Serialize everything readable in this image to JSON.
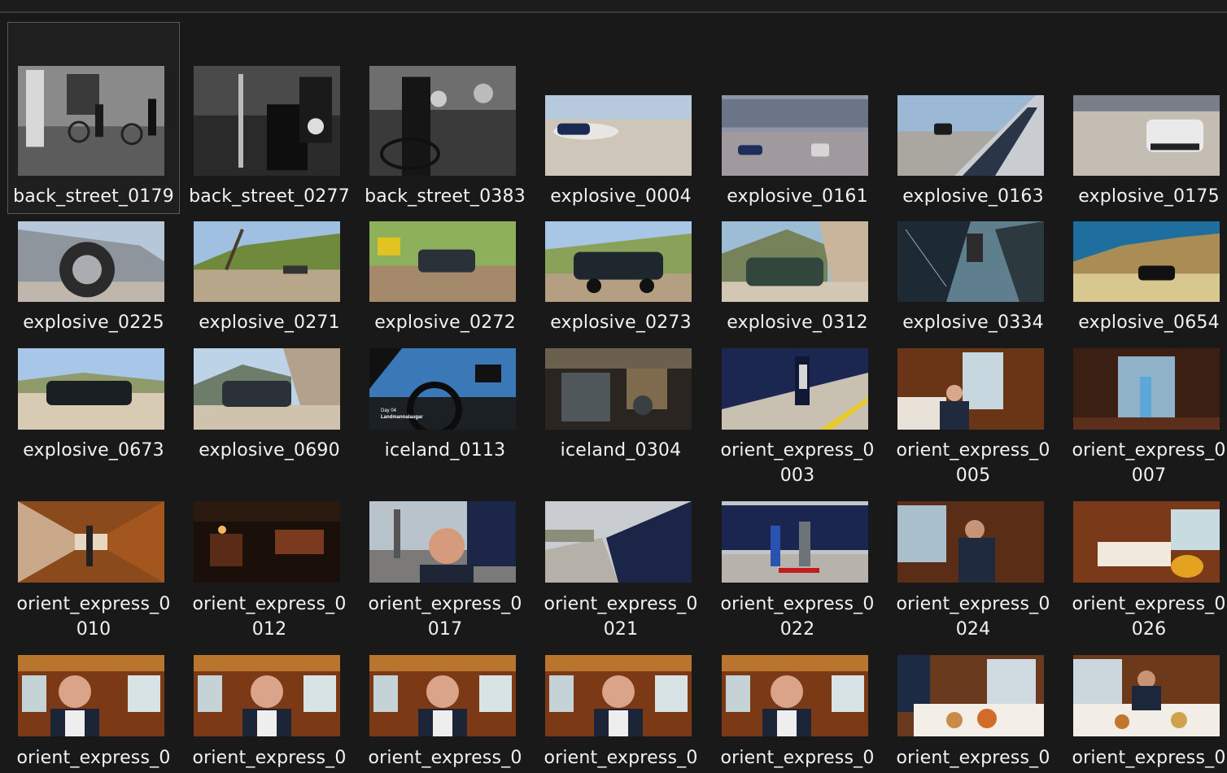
{
  "files": [
    {
      "name": "back_street_0179",
      "scene": "bw_street",
      "selected": true
    },
    {
      "name": "back_street_0277",
      "scene": "bw_carriage"
    },
    {
      "name": "back_street_0383",
      "scene": "bw_crowd"
    },
    {
      "name": "explosive_0004",
      "scene": "runway_car"
    },
    {
      "name": "explosive_0161",
      "scene": "runway_city"
    },
    {
      "name": "explosive_0163",
      "scene": "car_door"
    },
    {
      "name": "explosive_0175",
      "scene": "runway_white_car"
    },
    {
      "name": "explosive_0225",
      "scene": "wheel_closeup"
    },
    {
      "name": "explosive_0271",
      "scene": "hill_tree"
    },
    {
      "name": "explosive_0272",
      "scene": "hill_tow"
    },
    {
      "name": "explosive_0273",
      "scene": "hill_wagon"
    },
    {
      "name": "explosive_0312",
      "scene": "rock_wagon"
    },
    {
      "name": "explosive_0334",
      "scene": "broken_window"
    },
    {
      "name": "explosive_0654",
      "scene": "desert_hill_car"
    },
    {
      "name": "explosive_0673",
      "scene": "desert_wagon"
    },
    {
      "name": "explosive_0690",
      "scene": "mountain_wagon"
    },
    {
      "name": "iceland_0113",
      "scene": "car_interior_sky",
      "overlay": "Day 04\nLandmannalaugar"
    },
    {
      "name": "iceland_0304",
      "scene": "train_cab"
    },
    {
      "name": "orient_express_0\n003",
      "scene": "train_platform_blue"
    },
    {
      "name": "orient_express_0\n005",
      "scene": "cabin_man_window"
    },
    {
      "name": "orient_express_0\n007",
      "scene": "cabin_corridor_woman"
    },
    {
      "name": "orient_express_0\n010",
      "scene": "wood_corridor"
    },
    {
      "name": "orient_express_0\n012",
      "scene": "bar_car"
    },
    {
      "name": "orient_express_0\n017",
      "scene": "selfie_station"
    },
    {
      "name": "orient_express_0\n021",
      "scene": "platform_train_side"
    },
    {
      "name": "orient_express_0\n022",
      "scene": "train_porter"
    },
    {
      "name": "orient_express_0\n024",
      "scene": "man_window_cabin"
    },
    {
      "name": "orient_express_0\n026",
      "scene": "cabin_bed"
    },
    {
      "name": "orient_express_0",
      "scene": "cabin_selfie_a"
    },
    {
      "name": "orient_express_0",
      "scene": "cabin_selfie_b"
    },
    {
      "name": "orient_express_0",
      "scene": "cabin_selfie_c"
    },
    {
      "name": "orient_express_0",
      "scene": "cabin_selfie_d"
    },
    {
      "name": "orient_express_0",
      "scene": "cabin_selfie_e"
    },
    {
      "name": "orient_express_0",
      "scene": "dining_table"
    },
    {
      "name": "orient_express_0",
      "scene": "dining_table_man"
    }
  ]
}
